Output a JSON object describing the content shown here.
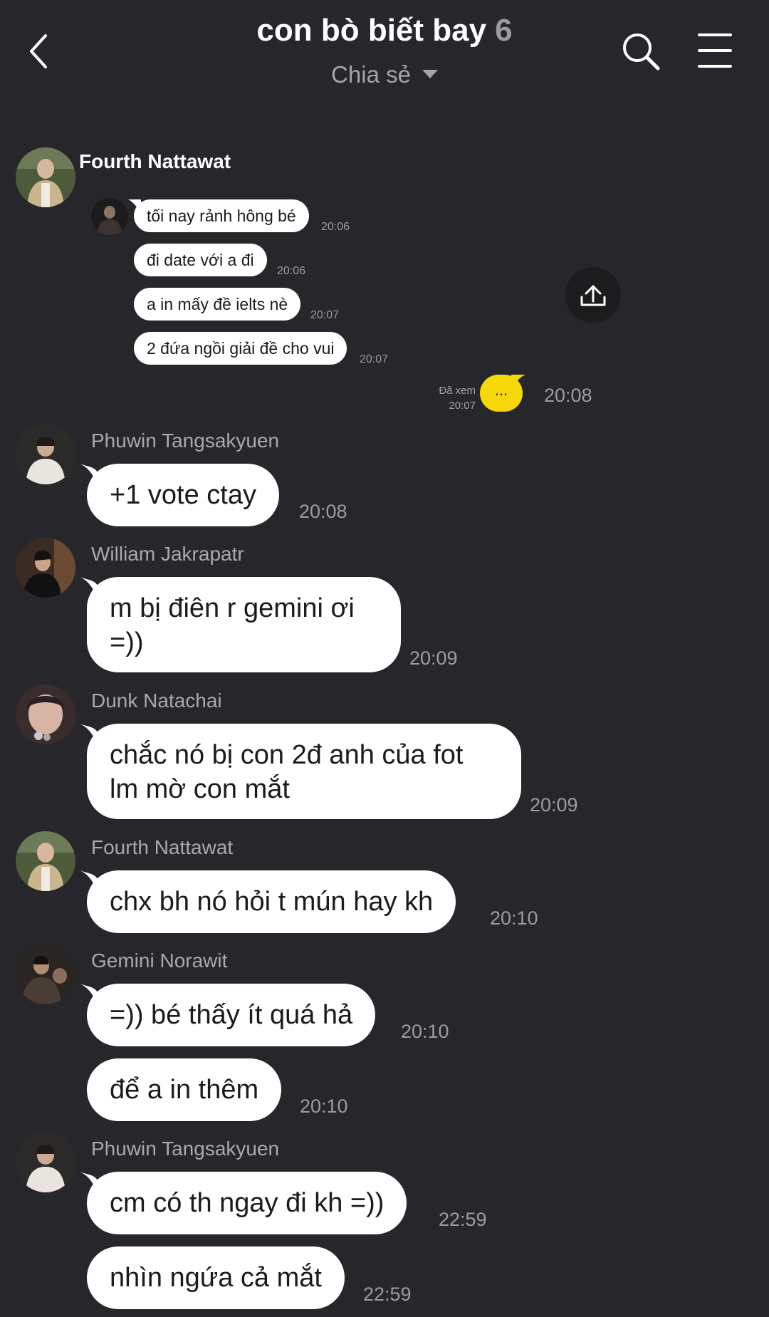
{
  "header": {
    "title": "con bò biết bay",
    "member_count": "6",
    "subtitle": "Chia sẻ"
  },
  "icons": {
    "back": "chevron-left-icon",
    "search": "search-icon",
    "menu": "hamburger-menu-icon",
    "share": "upload-share-icon"
  },
  "group1": {
    "sender": "Fourth Nattawat",
    "messages": [
      {
        "text": "tối nay rảnh hông bé",
        "time": "20:06"
      },
      {
        "text": "đi date với a đi",
        "time": "20:06"
      },
      {
        "text": "a in mấy đề ielts nè",
        "time": "20:07"
      },
      {
        "text": "2 đứa ngồi giải đề cho vui",
        "time": "20:07"
      }
    ]
  },
  "own": {
    "seen_label": "Đã xem",
    "seen_time": "20:07",
    "typing": "...",
    "time": "20:08"
  },
  "messages": [
    {
      "sender": "Phuwin Tangsakyuen",
      "text": "+1 vote ctay",
      "time": "20:08"
    },
    {
      "sender": "William Jakrapatr",
      "line1": "m bị điên r gemini ơi",
      "line2": "=))",
      "time": "20:09"
    },
    {
      "sender": "Dunk Natachai",
      "line1": "chắc nó bị con 2đ anh của fot",
      "line2": "lm mờ con mắt",
      "time": "20:09"
    },
    {
      "sender": "Fourth Nattawat",
      "text": "chx bh nó hỏi t mún hay kh",
      "time": "20:10"
    },
    {
      "sender": "Gemini Norawit",
      "text": "=)) bé thấy ít quá hả",
      "time": "20:10"
    },
    {
      "text": "để a in thêm",
      "time": "20:10"
    },
    {
      "sender": "Phuwin Tangsakyuen",
      "text": "cm có th ngay đi kh =))",
      "time": "22:59"
    },
    {
      "text": "nhìn ngứa cả mắt",
      "time": "22:59"
    }
  ],
  "colors": {
    "background": "#27272b",
    "bubble": "#ffffff",
    "typing_bubble": "#f5d70b",
    "muted_text": "#9b9ba0"
  }
}
